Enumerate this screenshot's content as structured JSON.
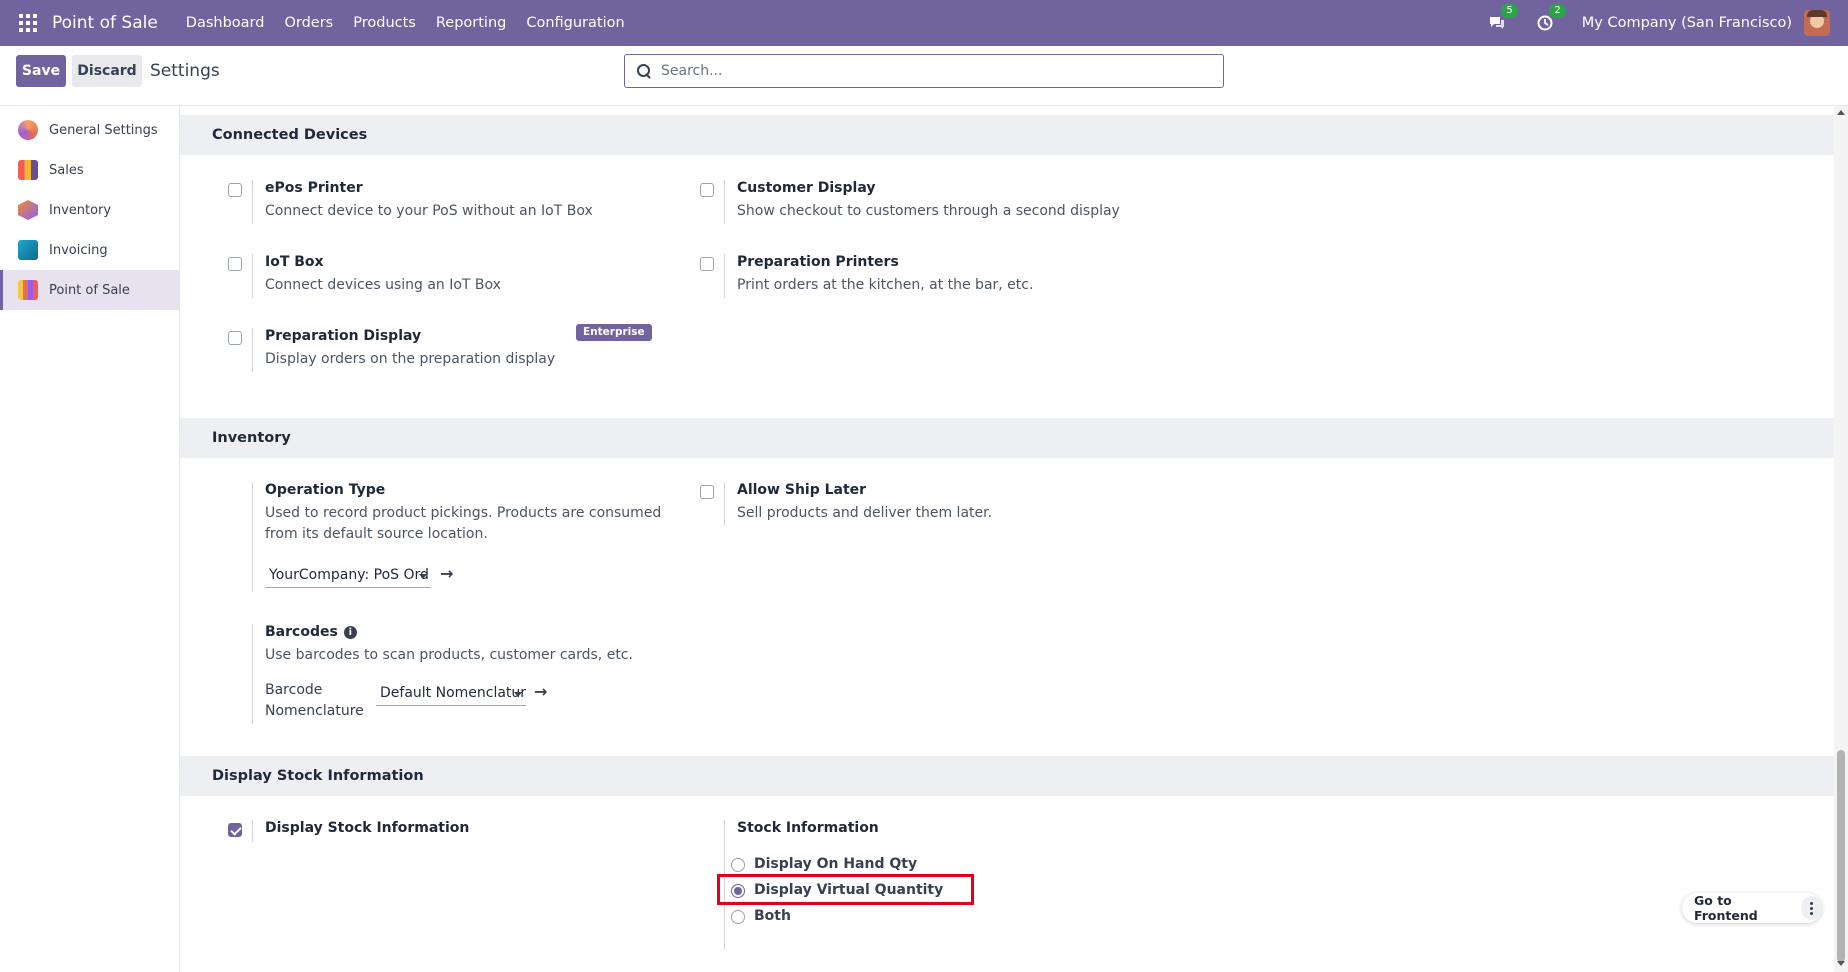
{
  "navbar": {
    "app_title": "Point of Sale",
    "menu": [
      "Dashboard",
      "Orders",
      "Products",
      "Reporting",
      "Configuration"
    ],
    "messages_count": "5",
    "activities_count": "2",
    "company": "My Company (San Francisco)"
  },
  "control": {
    "save_label": "Save",
    "discard_label": "Discard",
    "breadcrumb": "Settings",
    "search_placeholder": "Search..."
  },
  "sidebar": {
    "items": [
      {
        "label": "General Settings",
        "icon": "general-settings-icon"
      },
      {
        "label": "Sales",
        "icon": "sales-icon"
      },
      {
        "label": "Inventory",
        "icon": "inventory-icon"
      },
      {
        "label": "Invoicing",
        "icon": "invoicing-icon"
      },
      {
        "label": "Point of Sale",
        "icon": "pos-icon",
        "active": true
      }
    ]
  },
  "sections": {
    "connected_devices": {
      "title": "Connected Devices",
      "settings": [
        {
          "title": "ePos Printer",
          "desc": "Connect device to your PoS without an IoT Box",
          "checked": false
        },
        {
          "title": "Customer Display",
          "desc": "Show checkout to customers through a second display",
          "checked": false
        },
        {
          "title": "IoT Box",
          "desc": "Connect devices using an IoT Box",
          "checked": false
        },
        {
          "title": "Preparation Printers",
          "desc": "Print orders at the kitchen, at the bar, etc.",
          "checked": false
        },
        {
          "title": "Preparation Display",
          "desc": "Display orders on the preparation display",
          "checked": false,
          "badge": "Enterprise"
        }
      ]
    },
    "inventory": {
      "title": "Inventory",
      "operation_type": {
        "title": "Operation Type",
        "desc": "Used to record product pickings. Products are consumed from its default source location.",
        "value": "YourCompany: PoS Ord"
      },
      "allow_ship_later": {
        "title": "Allow Ship Later",
        "desc": "Sell products and deliver them later.",
        "checked": false
      },
      "barcodes": {
        "title": "Barcodes",
        "desc": "Use barcodes to scan products, customer cards, etc.",
        "field_label": "Barcode Nomenclature",
        "value": "Default Nomenclatur"
      }
    },
    "display_stock": {
      "title": "Display Stock Information",
      "checkbox_label": "Display Stock Information",
      "checked": true,
      "stock_info_title": "Stock Information",
      "options": [
        "Display On Hand Qty",
        "Display Virtual Quantity",
        "Both"
      ],
      "selected": "Display Virtual Quantity"
    }
  },
  "floating": {
    "go_frontend": "Go to Frontend"
  },
  "colors": {
    "brand": "#71639e",
    "highlight": "#e3001b",
    "badge_green": "#28a745"
  }
}
